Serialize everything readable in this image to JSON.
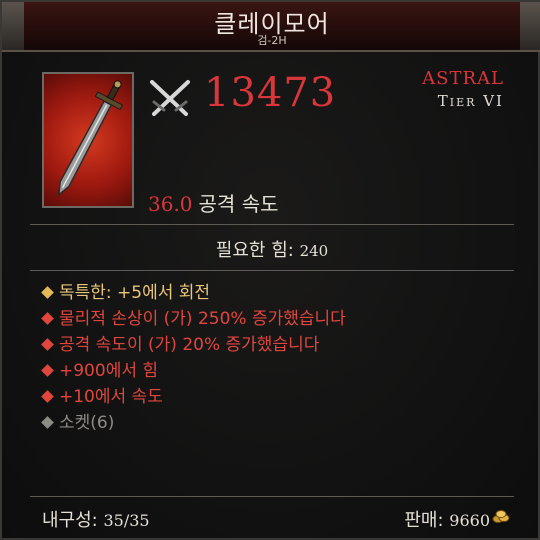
{
  "item": {
    "name": "클레이모어",
    "type": "검-2H",
    "damage": "13473",
    "rarity": "ASTRAL",
    "tier": "Tier VI",
    "attack_speed_value": "36.0",
    "attack_speed_label": "공격 속도"
  },
  "requirement": {
    "label": "필요한 힘:",
    "value": "240"
  },
  "affixes": [
    {
      "text": "독특한: +5에서 회전",
      "style": "gold"
    },
    {
      "text": "물리적 손상이 (가) 250% 증가했습니다",
      "style": "red"
    },
    {
      "text": "공격 속도이 (가) 20% 증가했습니다",
      "style": "red"
    },
    {
      "text": "+900에서 힘",
      "style": "red"
    },
    {
      "text": "+10에서 속도",
      "style": "red"
    },
    {
      "text": "소켓(6)",
      "style": "grey"
    }
  ],
  "footer": {
    "durability_label": "내구성:",
    "durability_value": "35/35",
    "sell_label": "판매:",
    "sell_value": "9660"
  },
  "icons": {
    "weapon_type": "crossed-swords-icon",
    "item_image": "sword-icon",
    "currency": "gold-coins-icon"
  },
  "colors": {
    "rarity": "#d8363a",
    "unique_affix": "#e8c67a",
    "magic_affix": "#e0463e",
    "socket": "#8e8a86"
  }
}
